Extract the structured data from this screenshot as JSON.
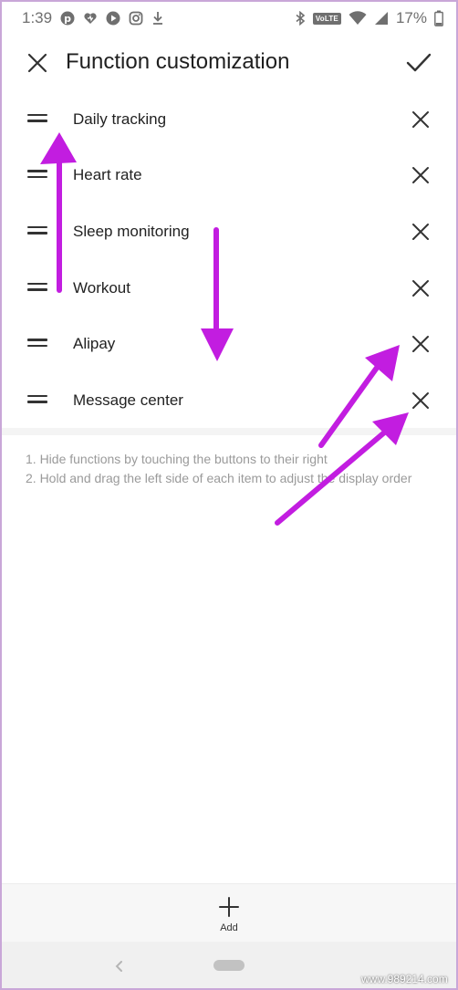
{
  "status_bar": {
    "time": "1:39",
    "network_badge": "VoLTE",
    "battery": "17%"
  },
  "header": {
    "title": "Function customization"
  },
  "functions": [
    {
      "label": "Daily tracking"
    },
    {
      "label": "Heart rate"
    },
    {
      "label": "Sleep monitoring"
    },
    {
      "label": "Workout"
    },
    {
      "label": "Alipay"
    },
    {
      "label": "Message center"
    }
  ],
  "instructions": {
    "line1": "1. Hide functions by touching the buttons to their right",
    "line2": "2. Hold and drag the left side of each item to adjust the display order"
  },
  "add_bar": {
    "add_label": "Add"
  },
  "watermark": "www.989214.com",
  "colors": {
    "annotation_arrow": "#c21de0",
    "text_primary": "#222222",
    "text_secondary": "#9a9a9a"
  },
  "icons": {
    "close": "close-icon",
    "confirm": "check-icon",
    "drag": "drag-handle-icon",
    "remove": "remove-x-icon",
    "add": "plus-icon"
  }
}
